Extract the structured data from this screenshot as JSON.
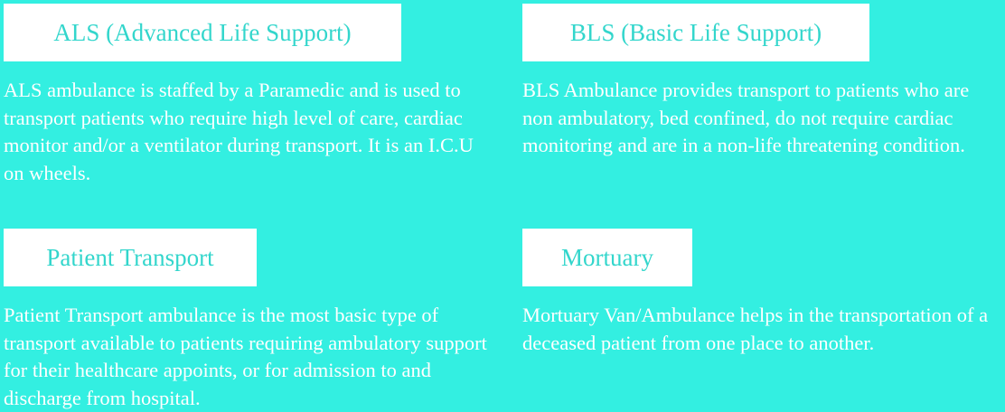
{
  "services": {
    "als": {
      "title": "ALS (Advanced Life Support)",
      "description": "ALS ambulance is staffed by a Paramedic and is used to transport patients who require high level of care, cardiac monitor and/or a ventilator during transport. It is an I.C.U on wheels."
    },
    "bls": {
      "title": "BLS (Basic Life Support)",
      "description": "BLS Ambulance provides transport to patients who are non ambulatory, bed confined, do not require cardiac monitoring and are in a non-life threatening condition."
    },
    "patient_transport": {
      "title": "Patient Transport",
      "description": "Patient Transport ambulance is the most basic type of transport available to patients requiring ambulatory support for their healthcare appoints, or for admission to and discharge from hospital."
    },
    "mortuary": {
      "title": "Mortuary",
      "description": "Mortuary Van/Ambulance helps in the transportation of a deceased patient from one place to another."
    }
  },
  "colors": {
    "background": "#33efe1",
    "tab_background": "#ffffff",
    "tab_text": "#33d6cc",
    "description_text": "#ffffff"
  }
}
